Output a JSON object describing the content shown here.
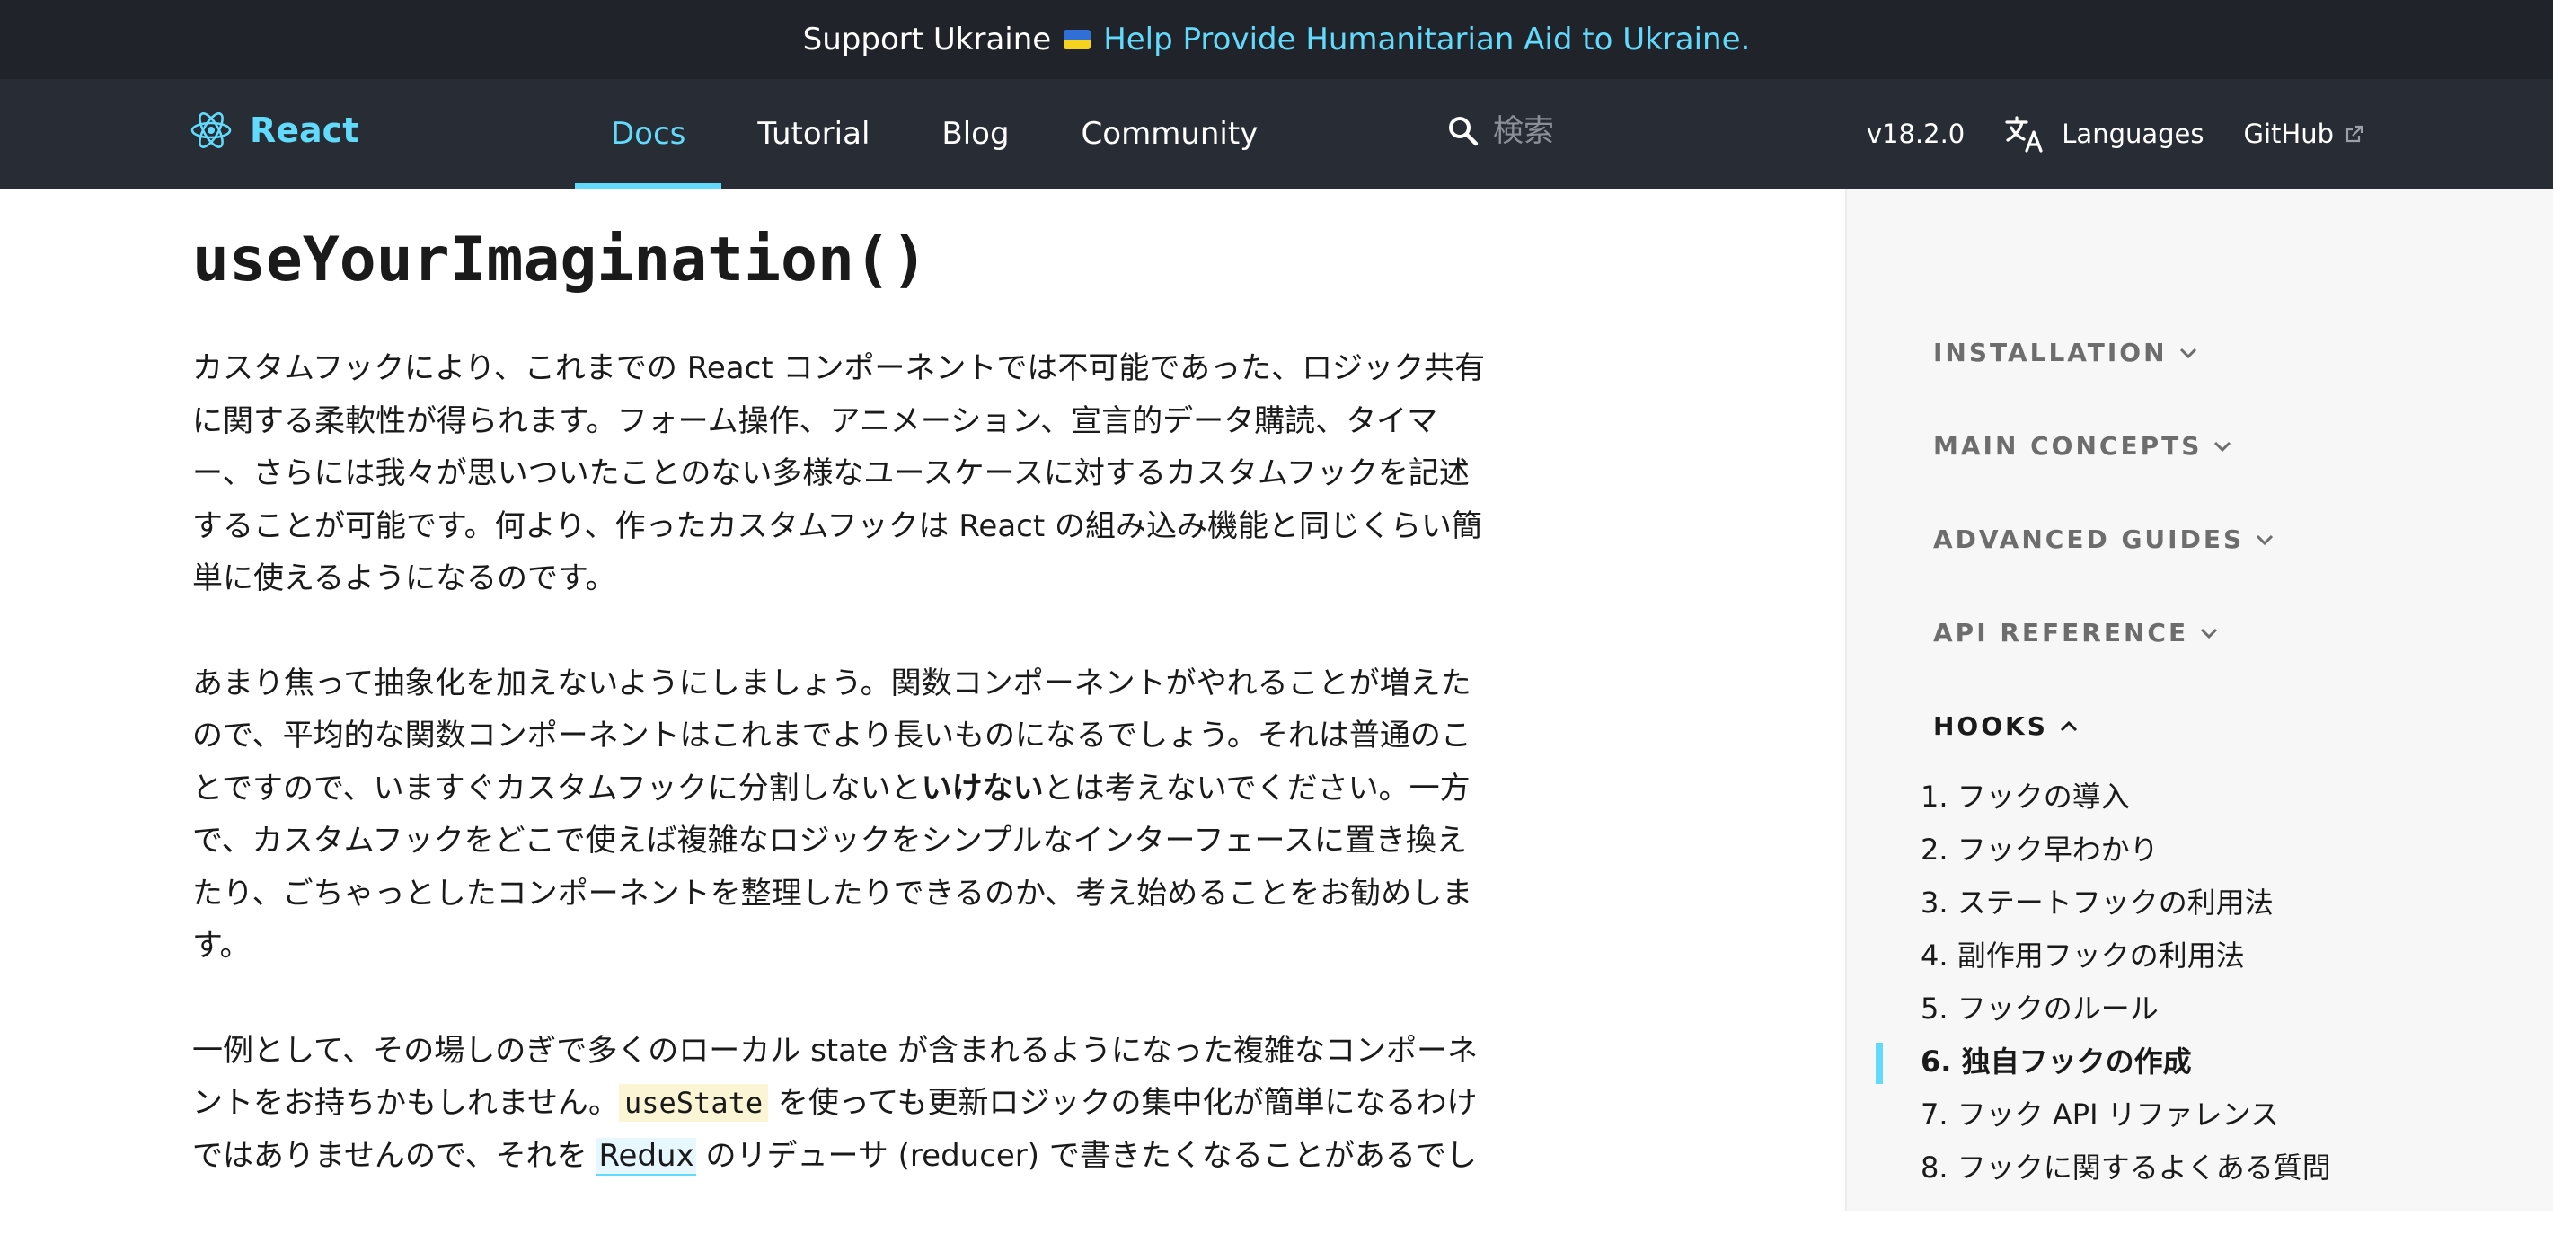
{
  "banner": {
    "text": "Support Ukraine",
    "link": "Help Provide Humanitarian Aid to Ukraine."
  },
  "nav": {
    "logo": "React",
    "links": [
      "Docs",
      "Tutorial",
      "Blog",
      "Community"
    ],
    "active": "Docs",
    "search_placeholder": "検索",
    "version": "v18.2.0",
    "languages": "Languages",
    "github": "GitHub"
  },
  "article": {
    "title": "useYourImagination()",
    "p1": "カスタムフックにより、これまでの React コンポーネントでは不可能であった、ロジック共有に関する柔軟性が得られます。フォーム操作、アニメーション、宣言的データ購読、タイマー、さらには我々が思いついたことのない多様なユースケースに対するカスタムフックを記述することが可能です。何より、作ったカスタムフックは React の組み込み機能と同じくらい簡単に使えるようになるのです。",
    "p2_a": "あまり焦って抽象化を加えないようにしましょう。関数コンポーネントがやれることが増えたので、平均的な関数コンポーネントはこれまでより長いものになるでしょう。それは普通のことですので、いますぐカスタムフックに分割しないと",
    "p2_bold": "いけない",
    "p2_b": "とは考えないでください。一方で、カスタムフックをどこで使えば複雑なロジックをシンプルなインターフェースに置き換えたり、ごちゃっとしたコンポーネントを整理したりできるのか、考え始めることをお勧めします。",
    "p3_a": "一例として、その場しのぎで多くのローカル state が含まれるようになった複雑なコンポーネントをお持ちかもしれません。",
    "p3_code": "useState",
    "p3_b": " を使っても更新ロジックの集中化が簡単になるわけではありませんので、それを ",
    "p3_link": "Redux",
    "p3_c": " のリデューサ (reducer) で書きたくなることがあるでし"
  },
  "sidebar": {
    "sections": [
      "INSTALLATION",
      "MAIN CONCEPTS",
      "ADVANCED GUIDES",
      "API REFERENCE",
      "HOOKS"
    ],
    "hooks": [
      "1. フックの導入",
      "2. フック早わかり",
      "3. ステートフックの利用法",
      "4. 副作用フックの利用法",
      "5. フックのルール",
      "6. 独自フックの作成",
      "7. フック API リファレンス",
      "8. フックに関するよくある質問"
    ],
    "active_index": 5
  },
  "colors": {
    "accent": "#61dafb",
    "nav_bg": "#282c34",
    "banner_bg": "#20232a",
    "sidebar_bg": "#f7f7f7"
  }
}
